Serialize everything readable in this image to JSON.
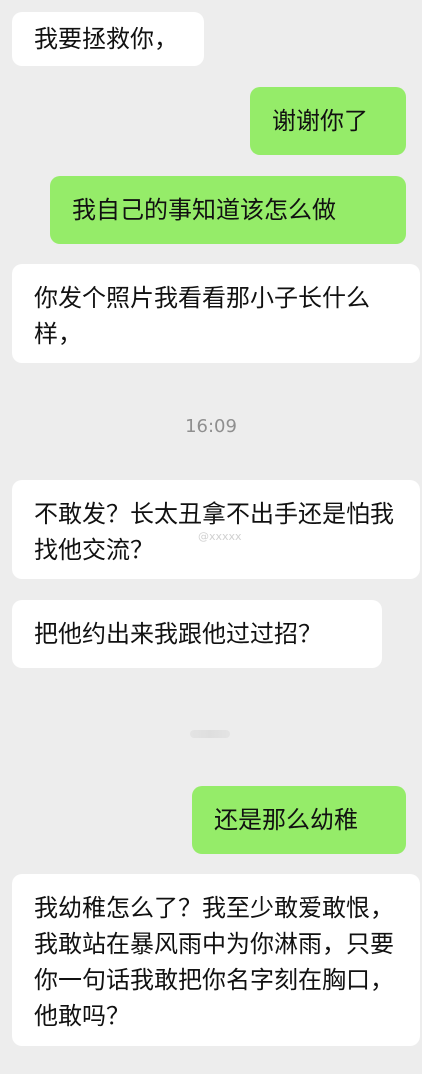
{
  "messages": [
    {
      "side": "left",
      "text": "我要拯救你，"
    },
    {
      "side": "right",
      "text": "谢谢你了"
    },
    {
      "side": "right",
      "text": "我自己的事知道该怎么做"
    },
    {
      "side": "left",
      "text": "你发个照片我看看那小子长什么样，"
    },
    {
      "side": "left",
      "text": "不敢发？长太丑拿不出手还是怕我找他交流？"
    },
    {
      "side": "left",
      "text": "把他约出来我跟他过过招？"
    },
    {
      "side": "right",
      "text": "还是那么幼稚"
    },
    {
      "side": "left",
      "text": "我幼稚怎么了？我至少敢爱敢恨，我敢站在暴风雨中为你淋雨，只要你一句话我敢把你名字刻在胸口，他敢吗？"
    }
  ],
  "timestamp": "16:09",
  "watermark": "@xxxxx"
}
